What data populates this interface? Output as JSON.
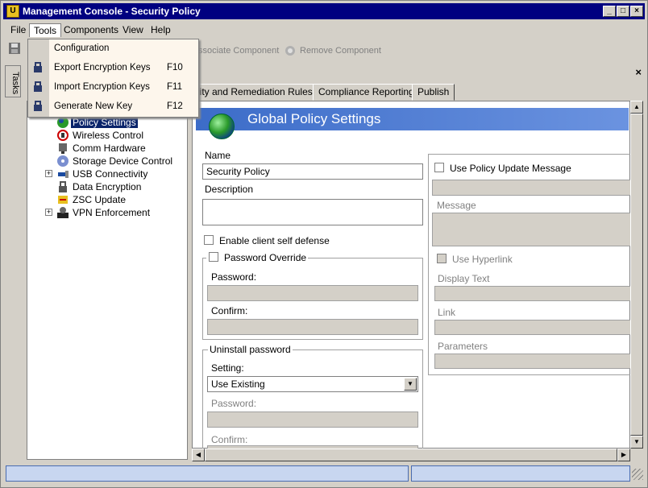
{
  "window": {
    "title": "Management Console - Security Policy"
  },
  "menubar": {
    "items": [
      "File",
      "Tools",
      "Components",
      "View",
      "Help"
    ]
  },
  "tools_menu": {
    "items": [
      {
        "label": "Configuration",
        "shortcut": ""
      },
      {
        "label": "Export Encryption Keys",
        "shortcut": "F10"
      },
      {
        "label": "Import Encryption Keys",
        "shortcut": "F11"
      },
      {
        "label": "Generate New Key",
        "shortcut": "F12"
      }
    ]
  },
  "toolbar": {
    "associate_label": "ssociate Component",
    "remove_label": "Remove Component"
  },
  "side_tab": {
    "label": "Tasks"
  },
  "tabs": [
    "urity and Remediation Rules",
    "Compliance Reporting",
    "Publish"
  ],
  "tree": {
    "items": [
      {
        "label": "Policy Settings",
        "icon": "globe-icon",
        "selected": true
      },
      {
        "label": "Wireless Control",
        "icon": "wireless-icon"
      },
      {
        "label": "Comm Hardware",
        "icon": "hardware-icon"
      },
      {
        "label": "Storage Device Control",
        "icon": "storage-icon"
      },
      {
        "label": "USB Connectivity",
        "icon": "usb-icon",
        "expandable": true
      },
      {
        "label": "Data Encryption",
        "icon": "lock-icon"
      },
      {
        "label": "ZSC Update",
        "icon": "update-icon"
      },
      {
        "label": "VPN Enforcement",
        "icon": "vpn-icon",
        "expandable": true
      }
    ]
  },
  "policy": {
    "header_title": "Global Policy Settings",
    "name_label": "Name",
    "name_value": "Security Policy",
    "description_label": "Description",
    "description_value": "",
    "self_defense_label": "Enable client self defense",
    "password_override": {
      "label": "Password Override",
      "password_label": "Password:",
      "confirm_label": "Confirm:"
    },
    "uninstall": {
      "label": "Uninstall password",
      "setting_label": "Setting:",
      "setting_value": "Use Existing",
      "password_label": "Password:",
      "confirm_label": "Confirm:"
    },
    "update_message": {
      "label": "Use Policy Update Message",
      "message_label": "Message",
      "hyperlink_label": "Use Hyperlink",
      "display_text_label": "Display Text",
      "link_label": "Link",
      "parameters_label": "Parameters"
    }
  },
  "colors": {
    "titlebar": "#000080",
    "header_gradient_start": "#3c6cc8",
    "selection": "#0a246a",
    "menu_background": "#fdf6ec"
  }
}
